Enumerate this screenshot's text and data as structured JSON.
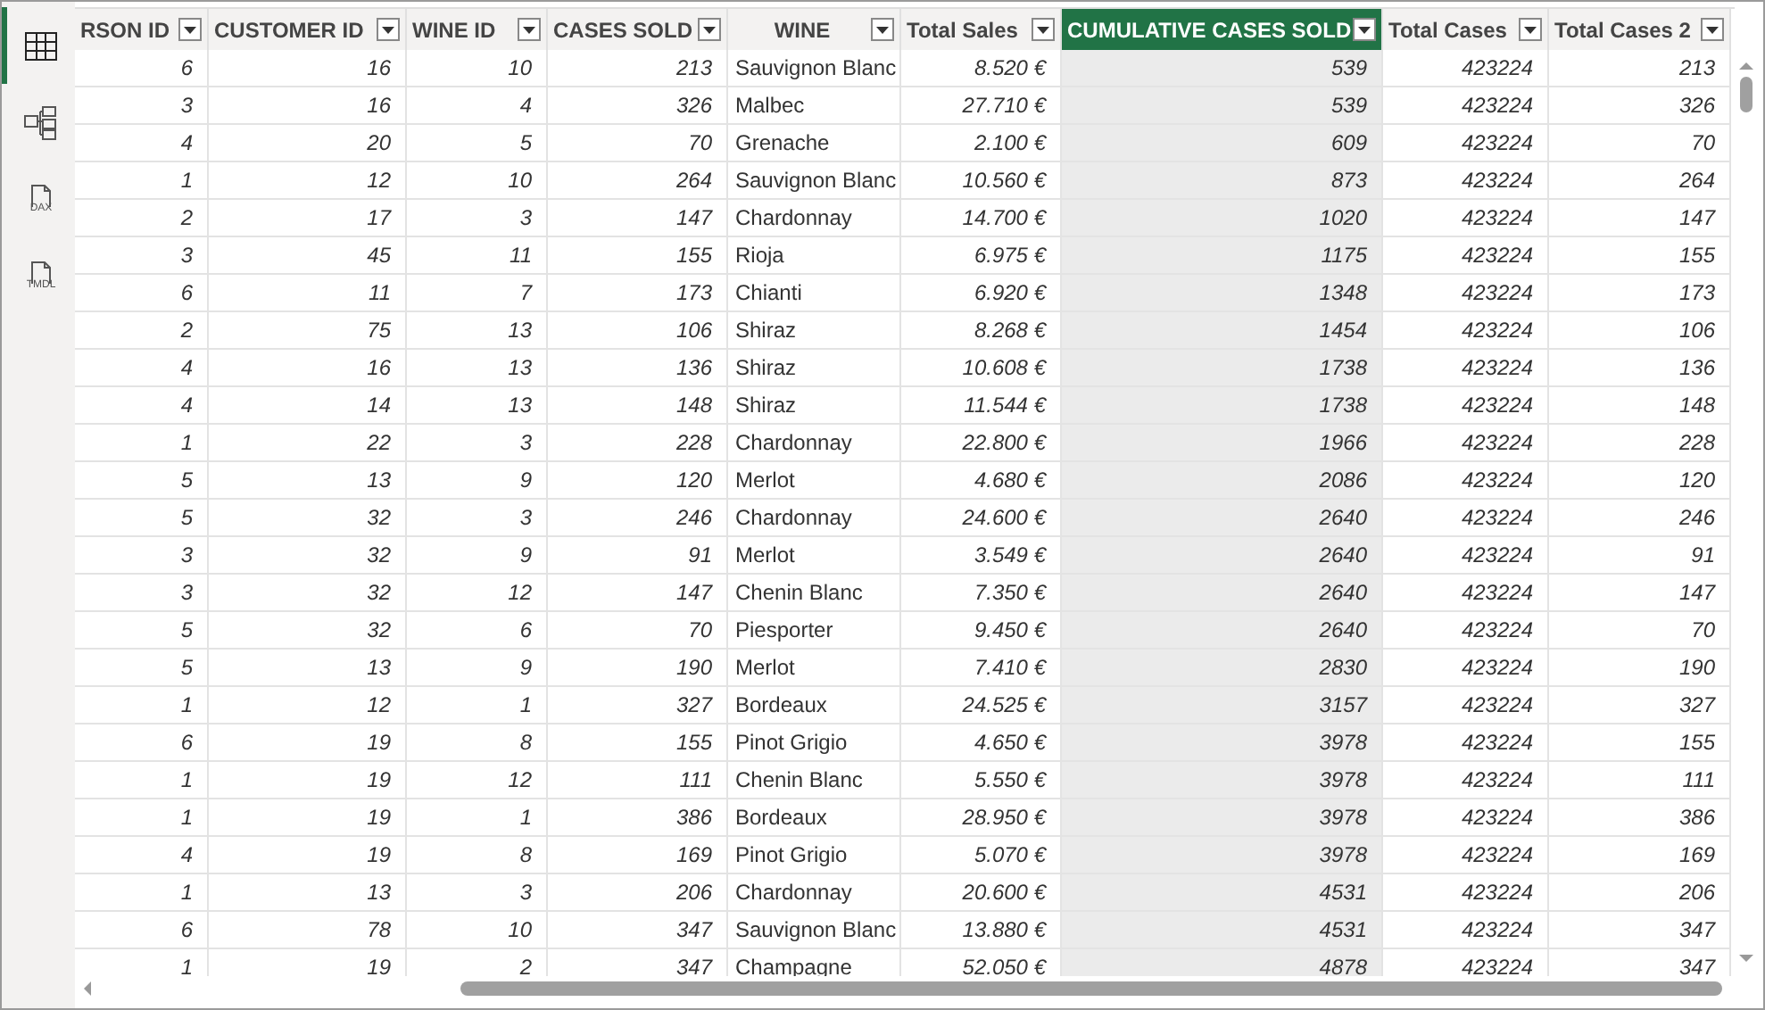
{
  "sidebar": {
    "items": [
      {
        "kind": "table",
        "selected": true
      },
      {
        "kind": "model",
        "selected": false
      },
      {
        "kind": "dax",
        "label": "DAX",
        "selected": false
      },
      {
        "kind": "tmdl",
        "label": "TMDL",
        "selected": false
      }
    ]
  },
  "table": {
    "columns": [
      {
        "label": "RSON ID",
        "kind": "number",
        "selected": false
      },
      {
        "label": "CUSTOMER ID",
        "kind": "number",
        "selected": false
      },
      {
        "label": "WINE ID",
        "kind": "number",
        "selected": false
      },
      {
        "label": "CASES SOLD",
        "kind": "number",
        "selected": false
      },
      {
        "label": "WINE",
        "kind": "text",
        "selected": false
      },
      {
        "label": "Total Sales",
        "kind": "number",
        "selected": false
      },
      {
        "label": "CUMULATIVE CASES SOLD",
        "kind": "number",
        "selected": true
      },
      {
        "label": "Total Cases",
        "kind": "number",
        "selected": false
      },
      {
        "label": "Total Cases 2",
        "kind": "number",
        "selected": false
      }
    ],
    "rows": [
      [
        "6",
        "16",
        "10",
        "213",
        "Sauvignon Blanc",
        "8.520 €",
        "539",
        "423224",
        "213"
      ],
      [
        "3",
        "16",
        "4",
        "326",
        "Malbec",
        "27.710 €",
        "539",
        "423224",
        "326"
      ],
      [
        "4",
        "20",
        "5",
        "70",
        "Grenache",
        "2.100 €",
        "609",
        "423224",
        "70"
      ],
      [
        "1",
        "12",
        "10",
        "264",
        "Sauvignon Blanc",
        "10.560 €",
        "873",
        "423224",
        "264"
      ],
      [
        "2",
        "17",
        "3",
        "147",
        "Chardonnay",
        "14.700 €",
        "1020",
        "423224",
        "147"
      ],
      [
        "3",
        "45",
        "11",
        "155",
        "Rioja",
        "6.975 €",
        "1175",
        "423224",
        "155"
      ],
      [
        "6",
        "11",
        "7",
        "173",
        "Chianti",
        "6.920 €",
        "1348",
        "423224",
        "173"
      ],
      [
        "2",
        "75",
        "13",
        "106",
        "Shiraz",
        "8.268 €",
        "1454",
        "423224",
        "106"
      ],
      [
        "4",
        "16",
        "13",
        "136",
        "Shiraz",
        "10.608 €",
        "1738",
        "423224",
        "136"
      ],
      [
        "4",
        "14",
        "13",
        "148",
        "Shiraz",
        "11.544 €",
        "1738",
        "423224",
        "148"
      ],
      [
        "1",
        "22",
        "3",
        "228",
        "Chardonnay",
        "22.800 €",
        "1966",
        "423224",
        "228"
      ],
      [
        "5",
        "13",
        "9",
        "120",
        "Merlot",
        "4.680 €",
        "2086",
        "423224",
        "120"
      ],
      [
        "5",
        "32",
        "3",
        "246",
        "Chardonnay",
        "24.600 €",
        "2640",
        "423224",
        "246"
      ],
      [
        "3",
        "32",
        "9",
        "91",
        "Merlot",
        "3.549 €",
        "2640",
        "423224",
        "91"
      ],
      [
        "3",
        "32",
        "12",
        "147",
        "Chenin Blanc",
        "7.350 €",
        "2640",
        "423224",
        "147"
      ],
      [
        "5",
        "32",
        "6",
        "70",
        "Piesporter",
        "9.450 €",
        "2640",
        "423224",
        "70"
      ],
      [
        "5",
        "13",
        "9",
        "190",
        "Merlot",
        "7.410 €",
        "2830",
        "423224",
        "190"
      ],
      [
        "1",
        "12",
        "1",
        "327",
        "Bordeaux",
        "24.525 €",
        "3157",
        "423224",
        "327"
      ],
      [
        "6",
        "19",
        "8",
        "155",
        "Pinot Grigio",
        "4.650 €",
        "3978",
        "423224",
        "155"
      ],
      [
        "1",
        "19",
        "12",
        "111",
        "Chenin Blanc",
        "5.550 €",
        "3978",
        "423224",
        "111"
      ],
      [
        "1",
        "19",
        "1",
        "386",
        "Bordeaux",
        "28.950 €",
        "3978",
        "423224",
        "386"
      ],
      [
        "4",
        "19",
        "8",
        "169",
        "Pinot Grigio",
        "5.070 €",
        "3978",
        "423224",
        "169"
      ],
      [
        "1",
        "13",
        "3",
        "206",
        "Chardonnay",
        "20.600 €",
        "4531",
        "423224",
        "206"
      ],
      [
        "6",
        "78",
        "10",
        "347",
        "Sauvignon Blanc",
        "13.880 €",
        "4531",
        "423224",
        "347"
      ],
      [
        "1",
        "19",
        "2",
        "347",
        "Champagne",
        "52.050 €",
        "4878",
        "423224",
        "347"
      ]
    ]
  }
}
